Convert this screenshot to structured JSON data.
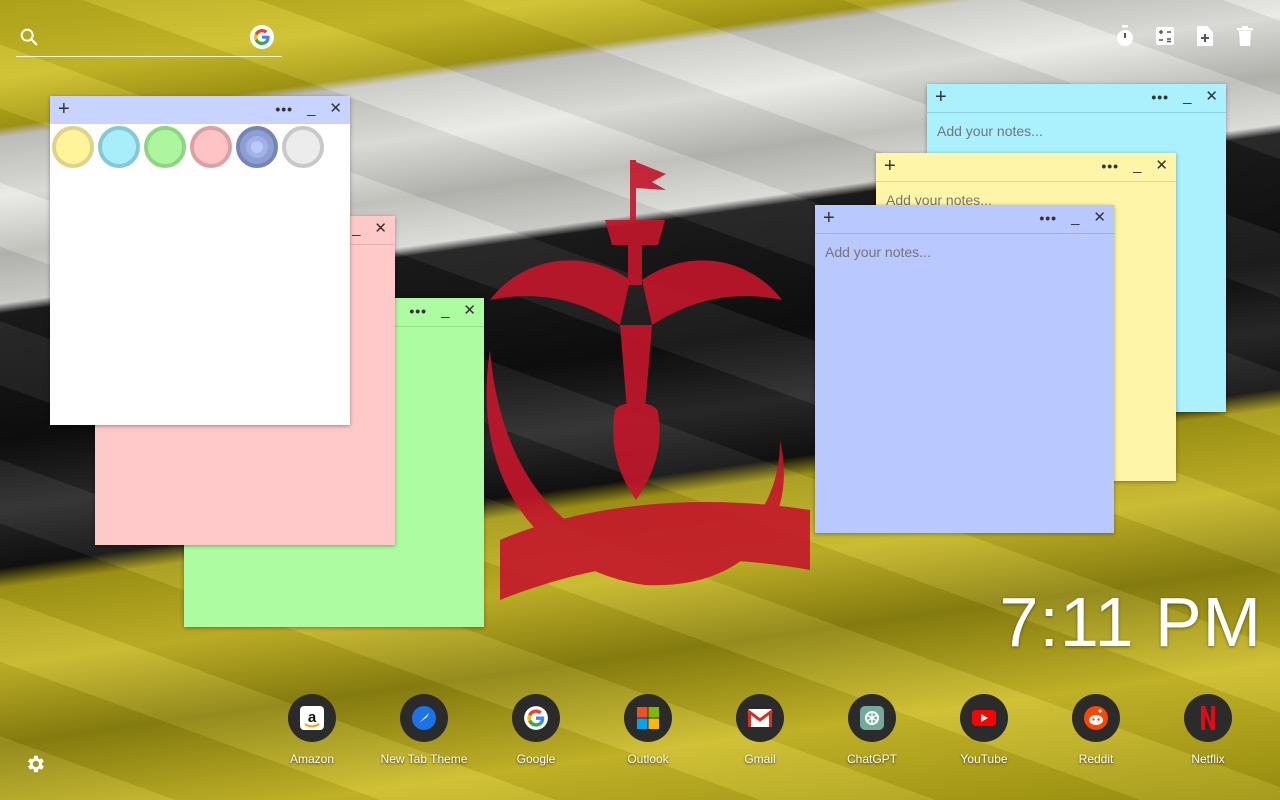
{
  "search": {
    "placeholder": ""
  },
  "tools": [
    "timer-icon",
    "calculator-icon",
    "add-file-icon",
    "trash-icon"
  ],
  "notes": {
    "cyan": {
      "placeholder": "Add your notes..."
    },
    "yellow": {
      "placeholder": "Add your notes..."
    },
    "blue": {
      "placeholder": "Add your notes..."
    },
    "green": {
      "placeholder": ""
    },
    "pink": {
      "placeholder": ""
    },
    "white": {
      "placeholder": ""
    }
  },
  "note_controls": {
    "add": "+",
    "menu": "•••",
    "minimize": "_",
    "close": "✕"
  },
  "color_swatches": [
    {
      "name": "yellow",
      "color": "#fff49a"
    },
    {
      "name": "cyan",
      "color": "#a8eefa"
    },
    {
      "name": "green",
      "color": "#aef59f"
    },
    {
      "name": "pink",
      "color": "#ffc3c6"
    },
    {
      "name": "blue",
      "color": "#8e9fd6",
      "selected": true
    },
    {
      "name": "gray",
      "color": "#ececec"
    }
  ],
  "clock": {
    "time": "7:11 PM"
  },
  "dock": {
    "apps": [
      {
        "label": "Amazon"
      },
      {
        "label": "New Tab Theme"
      },
      {
        "label": "Google"
      },
      {
        "label": "Outlook"
      },
      {
        "label": "Gmail"
      },
      {
        "label": "ChatGPT"
      },
      {
        "label": "YouTube"
      },
      {
        "label": "Reddit"
      },
      {
        "label": "Netflix"
      }
    ]
  }
}
